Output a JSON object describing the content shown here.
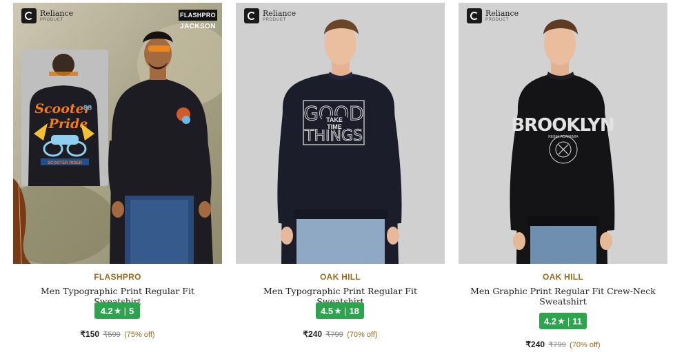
{
  "products": [
    {
      "logo_text": "Reliance",
      "logo_sub": "PRODUCT",
      "badge_brand": "FLASHPRO",
      "badge_model": "JACKSON",
      "brand": "FLASHPRO",
      "title": "Men Typographic Print Regular Fit Sweatshirt",
      "rating": "4.2",
      "star": "★",
      "rating_count": "5",
      "price": "₹150",
      "mrp": "₹599",
      "discount": "(75% off)"
    },
    {
      "logo_text": "Reliance",
      "logo_sub": "PRODUCT",
      "brand": "OAK HILL",
      "title": "Men Typographic Print Regular Fit Sweatshirt",
      "rating": "4.5",
      "star": "★",
      "rating_count": "18",
      "price": "₹240",
      "mrp": "₹799",
      "discount": "(70% off)"
    },
    {
      "logo_text": "Reliance",
      "logo_sub": "PRODUCT",
      "brand": "OAK HILL",
      "title": "Men Graphic Print Regular Fit Crew-Neck Sweatshirt",
      "rating": "4.2",
      "star": "★",
      "rating_count": "11",
      "price": "₹240",
      "mrp": "₹799",
      "discount": "(70% off)"
    }
  ],
  "graphics": {
    "print1_line1": "Scooter",
    "print1_line2": "Pride",
    "print1_num": "88",
    "print1_banner": "SCOOTER RIDER",
    "print2_line1": "GOOD",
    "print2_line2": "THINGS",
    "print2_inner1": "TAKE",
    "print2_inner2": "TIME",
    "print3_main": "BROOKLYN",
    "print3_sub": "REBEL ACADEMIA"
  },
  "colors": {
    "rating_green": "#2ea44f",
    "brand_gold": "#9a6b1a",
    "sweatshirt_dark": "#1c1c22"
  }
}
